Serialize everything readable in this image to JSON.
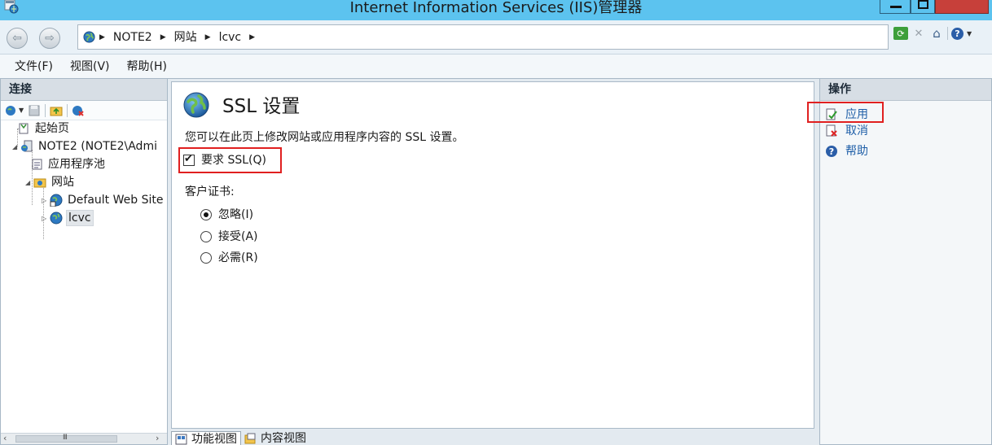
{
  "window": {
    "title": "Internet Information Services (IIS)管理器"
  },
  "address": {
    "crumbs": [
      "NOTE2",
      "网站",
      "lcvc"
    ]
  },
  "menu": {
    "items": [
      "文件(F)",
      "视图(V)",
      "帮助(H)"
    ]
  },
  "connections": {
    "header": "连接",
    "tree": {
      "start_page": "起始页",
      "server": "NOTE2 (NOTE2\\Admi",
      "app_pools": "应用程序池",
      "sites": "网站",
      "default_site": "Default Web Site",
      "lcvc": "lcvc"
    }
  },
  "main": {
    "title": "SSL 设置",
    "description": "您可以在此页上修改网站或应用程序内容的 SSL 设置。",
    "require_ssl": {
      "label": "要求 SSL(Q)",
      "checked": true
    },
    "client_cert": {
      "label": "客户证书:",
      "options": [
        {
          "label": "忽略(I)",
          "selected": true
        },
        {
          "label": "接受(A)",
          "selected": false
        },
        {
          "label": "必需(R)",
          "selected": false
        }
      ]
    },
    "tabs": [
      "功能视图",
      "内容视图"
    ]
  },
  "actions": {
    "header": "操作",
    "items": [
      "应用",
      "取消",
      "帮助"
    ]
  },
  "colors": {
    "highlight": "#e02020",
    "link": "#1f5fa8",
    "titlebar": "#5cc3ef"
  }
}
